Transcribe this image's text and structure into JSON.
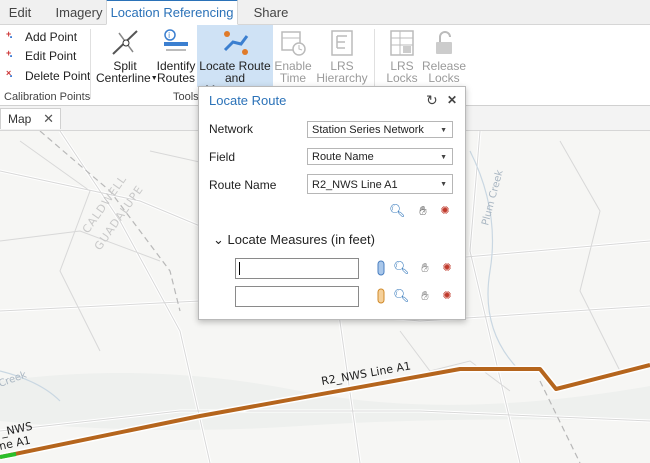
{
  "tabs": [
    {
      "label": "Edit"
    },
    {
      "label": "Imagery"
    },
    {
      "label": "Location Referencing",
      "active": true
    },
    {
      "label": "Share"
    }
  ],
  "ribbon": {
    "calibration": {
      "add_point": "Add Point",
      "edit_point": "Edit Point",
      "delete_point": "Delete Point",
      "group_label": "Calibration Points"
    },
    "tools": {
      "split_line1": "Split",
      "split_line2": "Centerline",
      "identify_line1": "Identify",
      "identify_line2": "Routes",
      "locate_line1": "Locate Route",
      "locate_line2": "and Measures",
      "enable_line1": "Enable",
      "enable_line2": "Time",
      "lrs_line1": "LRS",
      "lrs_line2": "Hierarchy",
      "group_label": "Tools"
    },
    "locks": {
      "lrs_locks_line1": "LRS",
      "lrs_locks_line2": "Locks",
      "release_line1": "Release",
      "release_line2": "Locks"
    }
  },
  "map_tab": {
    "label": "Map",
    "close": "✕"
  },
  "map": {
    "route_label_main": "R2_NWS Line A1",
    "route_label_left_1": "_NWS",
    "route_label_left_2": "ne A1",
    "place_labels": [
      "CALDWELL",
      "GUADALUPE",
      "Plum Creek",
      "Creek"
    ]
  },
  "panel": {
    "title": "Locate Route",
    "refresh_icon": "↻",
    "close_icon": "✕",
    "network_label": "Network",
    "network_value": "Station Series Network",
    "field_label": "Field",
    "field_value": "Route Name",
    "route_name_label": "Route Name",
    "route_name_value": "R2_NWS Line A1",
    "section_label": "Locate Measures (in feet)",
    "section_toggle": "⌄",
    "measure1_value": "",
    "measure2_value": ""
  },
  "colors": {
    "accent": "#2b72b8",
    "route": "#b5651d",
    "selected_button": "#cfe2f5"
  }
}
